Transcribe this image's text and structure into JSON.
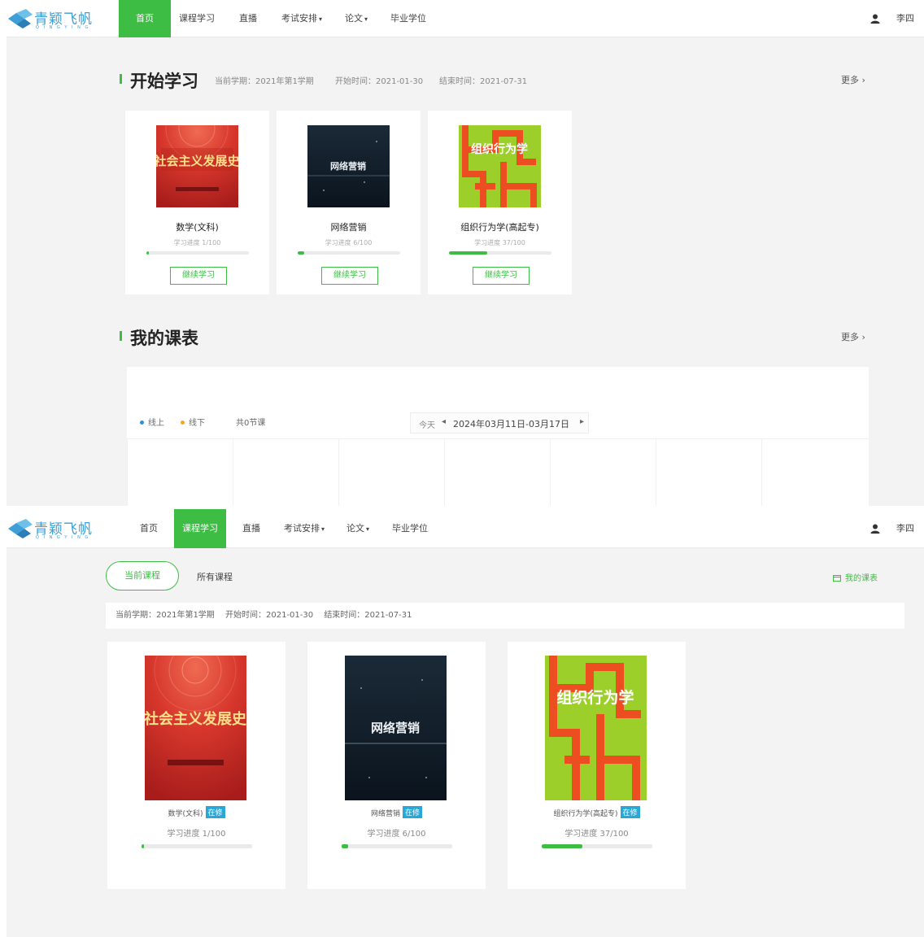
{
  "app": {
    "logo_text": "青颖飞帆",
    "logo_subtext": "Q I N G Y I N G",
    "user_name": "李四",
    "colors": {
      "accent": "#3ebd45",
      "tag": "#29a8d8",
      "online": "#2f8fd8",
      "offline": "#f5a623"
    }
  },
  "nav": {
    "items": [
      {
        "label": "首页"
      },
      {
        "label": "课程学习"
      },
      {
        "label": "直播"
      },
      {
        "label": "考试安排"
      },
      {
        "label": "论文"
      },
      {
        "label": "毕业学位"
      }
    ],
    "dropdown_caret": "▾"
  },
  "home": {
    "start_section": {
      "title": "开始学习",
      "term": "当前学期：2021年第1学期",
      "start_time": "开始时间：2021-01-30",
      "end_time": "结束时间：2021-07-31",
      "more": "更多 ›"
    },
    "courses": [
      {
        "name": "数学(文科)",
        "progress_text": "学习进度 1/100",
        "progress": 0.01,
        "button": "继续学习",
        "cover_icon": "red-cover"
      },
      {
        "name": "网络营销",
        "progress_text": "学习进度 6/100",
        "progress": 0.06,
        "button": "继续学习",
        "cover_icon": "dark-cover"
      },
      {
        "name": "组织行为学(高起专)",
        "progress_text": "学习进度 37/100",
        "progress": 0.37,
        "button": "继续学习",
        "cover_icon": "green-cover"
      }
    ],
    "schedule_section": {
      "title": "我的课表",
      "more": "更多 ›",
      "legend_online": "线上",
      "legend_offline": "线下",
      "lesson_count": "共0节课",
      "today": "今天",
      "prev": "◂",
      "next": "▸",
      "week_range": "2024年03月11日-03月17日"
    }
  },
  "courses_page": {
    "tab_current": "当前课程",
    "tab_all": "所有课程",
    "my_schedule_link": "我的课表",
    "term": "当前学期：2021年第1学期",
    "start_time": "开始时间：2021-01-30",
    "end_time": "结束时间：2021-07-31",
    "courses": [
      {
        "name": "数学(文科)",
        "tag": "在修",
        "progress_text": "学习进度 1/100",
        "progress": 0.01
      },
      {
        "name": "网络营销",
        "tag": "在修",
        "progress_text": "学习进度 6/100",
        "progress": 0.06
      },
      {
        "name": "组织行为学(高起专)",
        "tag": "在修",
        "progress_text": "学习进度 37/100",
        "progress": 0.37
      }
    ]
  },
  "covers": {
    "red_title": "社会主义发展史",
    "dark_title": "网络营销",
    "green_title": "组织行为学"
  }
}
